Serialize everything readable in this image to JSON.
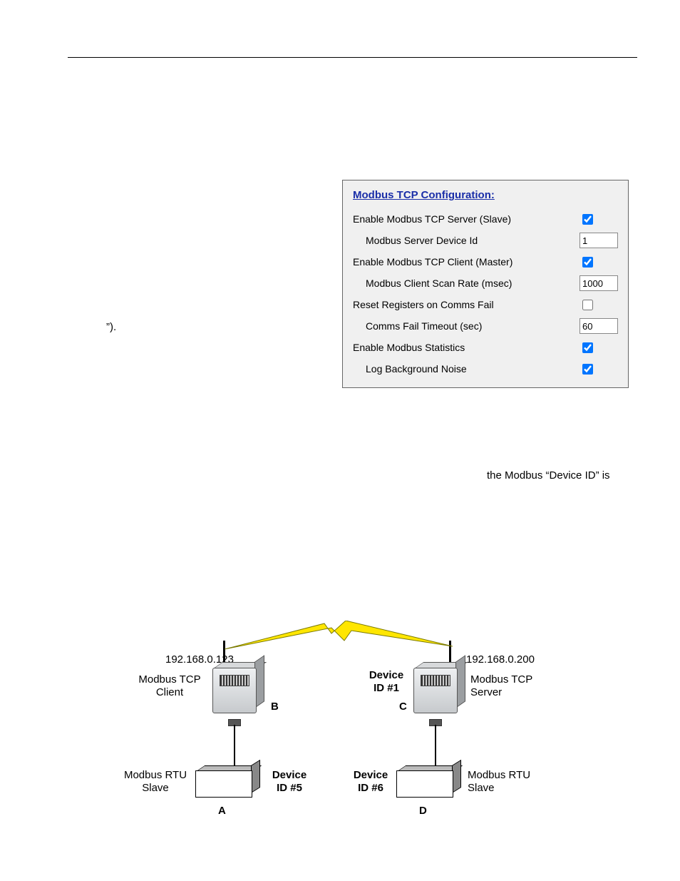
{
  "page_header_rule": true,
  "paragraph_fragment_quote_close": "”).",
  "paragraph_fragment_mid": "the Modbus “Device ID” is",
  "config": {
    "title": "Modbus TCP Configuration:",
    "rows": [
      {
        "label": "Enable Modbus TCP Server (Slave)",
        "type": "check",
        "checked": true,
        "indent": false,
        "name": "enable-tcp-server"
      },
      {
        "label": "Modbus Server Device Id",
        "type": "text",
        "value": "1",
        "indent": true,
        "name": "server-device-id"
      },
      {
        "label": "Enable Modbus TCP Client (Master)",
        "type": "check",
        "checked": true,
        "indent": false,
        "name": "enable-tcp-client"
      },
      {
        "label": "Modbus Client Scan Rate (msec)",
        "type": "text",
        "value": "1000",
        "indent": true,
        "name": "client-scan-rate"
      },
      {
        "label": "Reset Registers on Comms Fail",
        "type": "check",
        "checked": false,
        "indent": false,
        "name": "reset-on-fail"
      },
      {
        "label": "Comms Fail Timeout (sec)",
        "type": "text",
        "value": "60",
        "indent": true,
        "name": "fail-timeout"
      },
      {
        "label": "Enable Modbus Statistics",
        "type": "check",
        "checked": true,
        "indent": false,
        "name": "enable-stats"
      },
      {
        "label": "Log Background Noise",
        "type": "check",
        "checked": true,
        "indent": true,
        "name": "log-noise"
      }
    ]
  },
  "diagram": {
    "left_ip": "192.168.0.123",
    "right_ip": "192.168.0.200",
    "left_role_l1": "Modbus TCP",
    "left_role_l2": "Client",
    "right_role_l1": "Modbus TCP",
    "right_role_l2": "Server",
    "center_id_l1": "Device",
    "center_id_l2": "ID #1",
    "slave_left_l1": "Modbus RTU",
    "slave_left_l2": "Slave",
    "slave_right_l1": "Modbus RTU",
    "slave_right_l2": "Slave",
    "dev5_l1": "Device",
    "dev5_l2": "ID #5",
    "dev6_l1": "Device",
    "dev6_l2": "ID #6",
    "A": "A",
    "B": "B",
    "C": "C",
    "D": "D"
  }
}
